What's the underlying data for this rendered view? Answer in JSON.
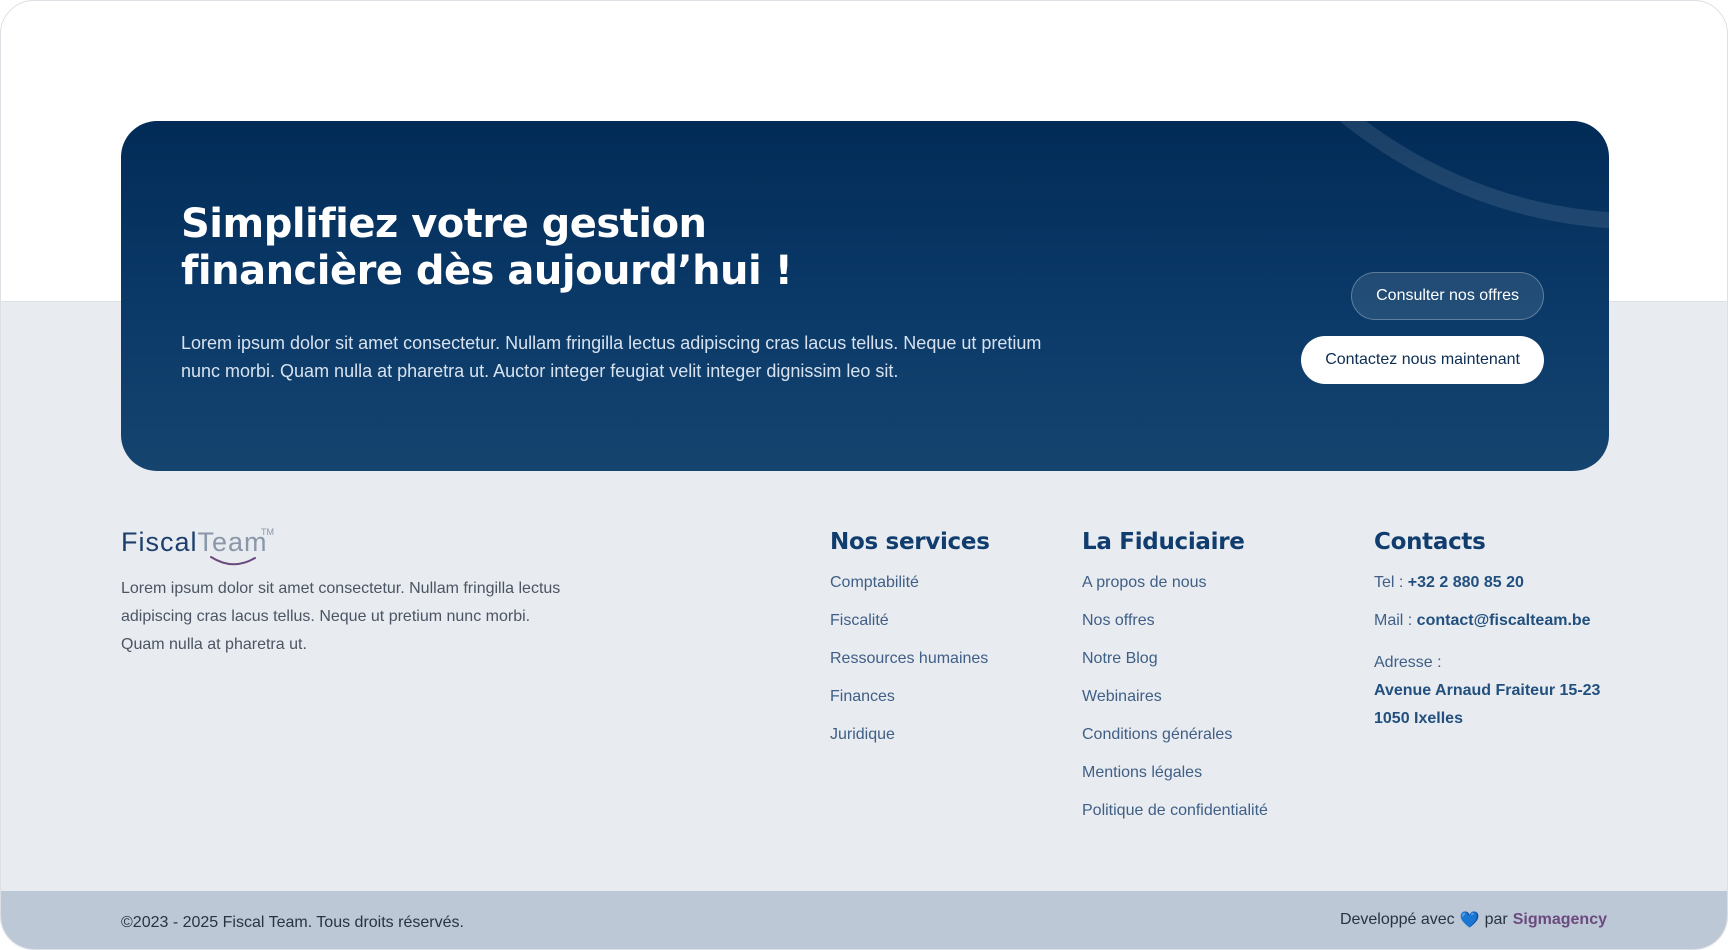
{
  "cta": {
    "title": "Simplifiez votre gestion financière dès aujourd’hui !",
    "text": "Lorem ipsum dolor sit amet consectetur. Nullam fringilla lectus adipiscing cras lacus tellus. Neque ut pretium nunc morbi. Quam nulla at pharetra ut. Auctor integer feugiat velit integer dignissim leo sit.",
    "button_offers": "Consulter nos offres",
    "button_contact": "Contactez nous maintenant"
  },
  "logo": {
    "part1": "Fiscal",
    "part2": "Team",
    "tm": "TM"
  },
  "about": {
    "text": "Lorem ipsum dolor sit amet consectetur. Nullam fringilla lectus adipiscing cras lacus tellus. Neque ut pretium nunc morbi. Quam nulla at pharetra ut."
  },
  "services": {
    "title": "Nos services",
    "items": [
      "Comptabilité",
      "Fiscalité",
      "Ressources humaines",
      "Finances",
      "Juridique"
    ]
  },
  "fiduciaire": {
    "title": "La Fiduciaire",
    "items": [
      "A propos de nous",
      "Nos offres",
      "Notre Blog",
      "Webinaires",
      "Conditions générales",
      "Mentions légales",
      "Politique de confidentialité"
    ]
  },
  "contacts": {
    "title": "Contacts",
    "tel_label": "Tel : ",
    "tel_value": "+32 2 880 85 20",
    "mail_label": "Mail : ",
    "mail_value": "contact@fiscalteam.be",
    "address_label": "Adresse :",
    "address_line1": "Avenue Arnaud Fraiteur 15-23",
    "address_line2": "1050 Ixelles"
  },
  "bottom": {
    "copyright": "©2023 - 2025 Fiscal Team. Tous droits réservés.",
    "credit_prefix": "Developpé avec",
    "credit_heart": "💙",
    "credit_by": "par",
    "credit_brand": "Sigmagency"
  },
  "colors": {
    "banner_dark": "#022b57",
    "banner_light": "#15446f",
    "footer_bg": "#e8ebf0",
    "bottom_bar": "#bcc8d5",
    "link": "#3f5f86",
    "heading": "#103d6e",
    "brand_accent": "#6b4a7e"
  }
}
